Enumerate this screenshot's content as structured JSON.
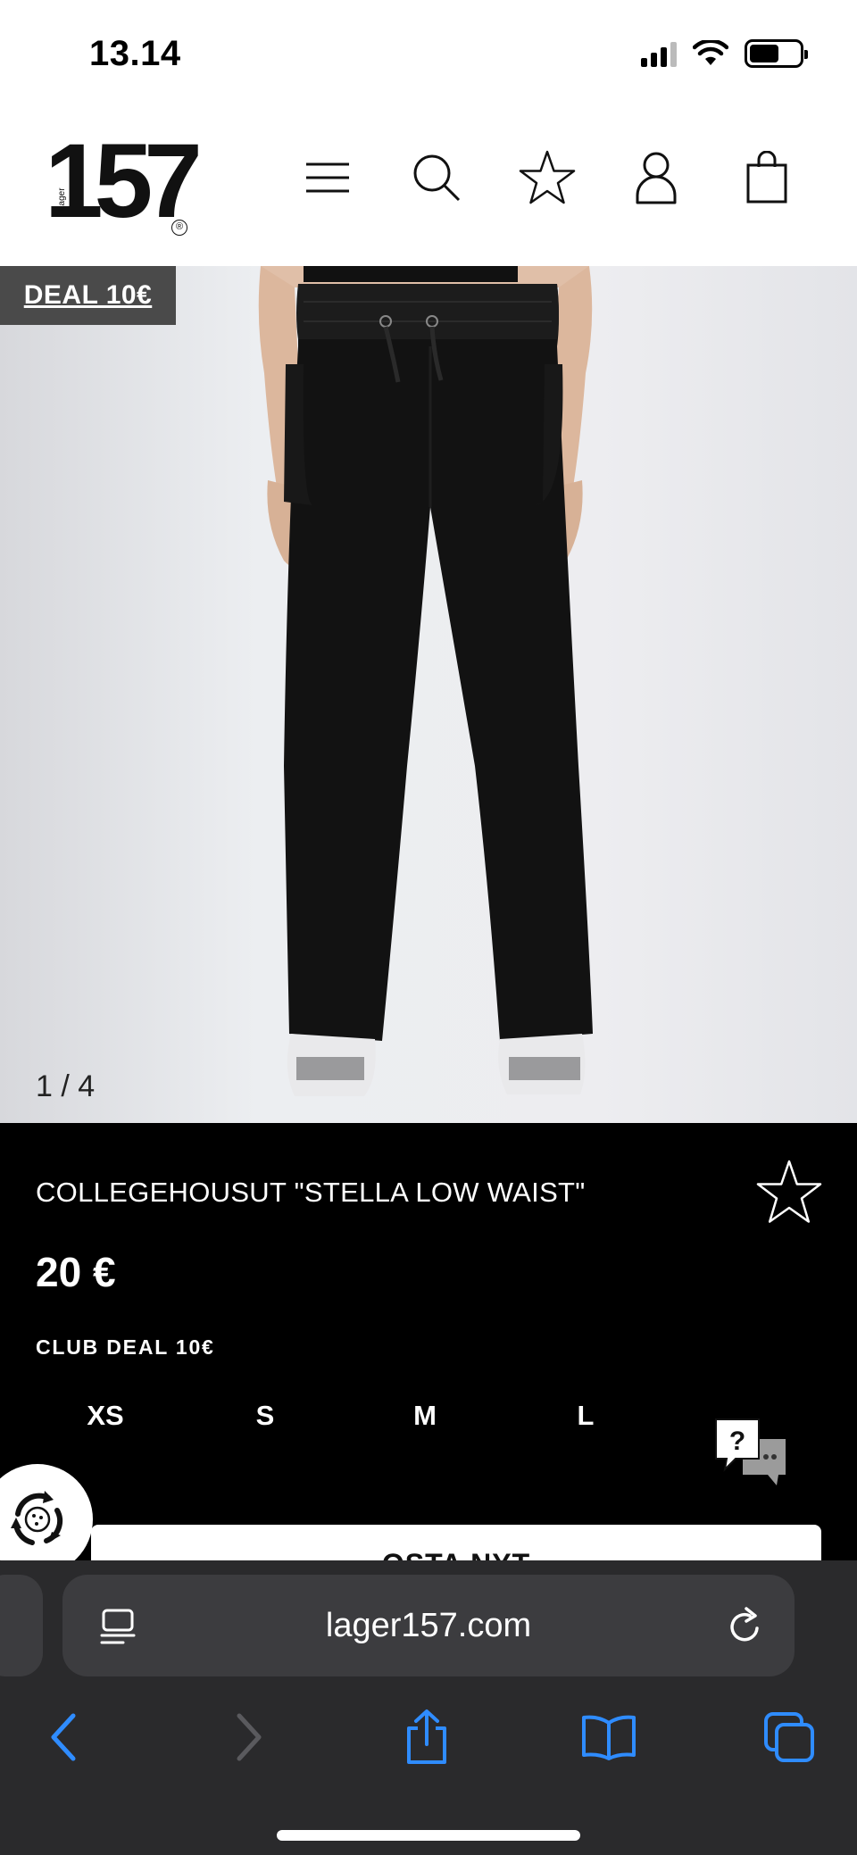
{
  "status_bar": {
    "time": "13.14",
    "icons": [
      "cellular-signal-icon",
      "wifi-icon",
      "battery-icon"
    ]
  },
  "header": {
    "logo": {
      "number": "157",
      "lager": "Lager",
      "registered": "®"
    },
    "icons": [
      "menu-icon",
      "search-icon",
      "star-icon",
      "user-icon",
      "bag-icon"
    ]
  },
  "hero": {
    "badge": "DEAL 10€",
    "image_counter": "1 / 4"
  },
  "product": {
    "title": "COLLEGEHOUSUT \"STELLA LOW WAIST\"",
    "price": "20 €",
    "club_deal": "CLUB DEAL 10€",
    "sizes": [
      "XS",
      "S",
      "M",
      "L"
    ],
    "buy_label": "OSTA NYT"
  },
  "browser": {
    "url": "lager157.com",
    "toolbar": [
      "back-icon",
      "forward-icon",
      "share-icon",
      "bookmarks-icon",
      "tabs-icon"
    ]
  },
  "colors": {
    "accent_ios": "#2f8cff",
    "disabled": "#5a5a5e",
    "deal_badge": "#4a4a4a"
  }
}
